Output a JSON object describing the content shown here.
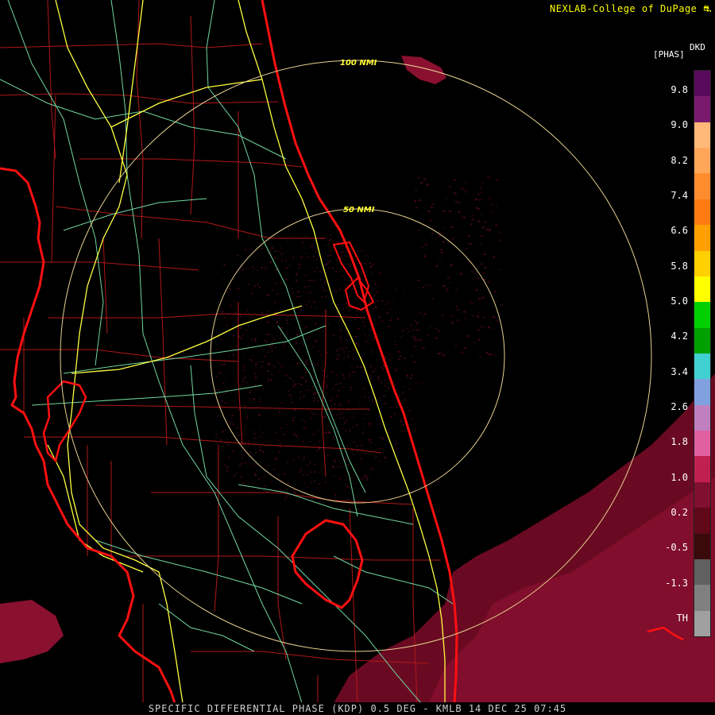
{
  "header": {
    "credit": "NEXLAB-College of DuPage",
    "credit_mark": "⛐"
  },
  "footer": {
    "caption": "SPECIFIC DIFFERENTIAL PHASE (KDP) 0.5 DEG - KMLB 14 DEC 25 07:45"
  },
  "range_rings": [
    {
      "label": "100 NMI"
    },
    {
      "label": "50 NMI"
    }
  ],
  "legend": {
    "unit": "[PHAS]",
    "code": "DKD",
    "ticks": [
      "9.8",
      "9.0",
      "8.2",
      "7.4",
      "6.6",
      "5.8",
      "5.0",
      "4.2",
      "3.4",
      "2.6",
      "1.8",
      "1.0",
      "0.2",
      "-0.5",
      "-1.3",
      "TH"
    ],
    "colors": [
      "#5a0a5a",
      "#7a1a6e",
      "#ffb877",
      "#ffa65a",
      "#ff8c2e",
      "#ff7a10",
      "#ffa000",
      "#ffd000",
      "#ffff00",
      "#00d000",
      "#00a000",
      "#40d0d0",
      "#80a0e0",
      "#c080c0",
      "#e060a0",
      "#c02050",
      "#801030",
      "#600818",
      "#3a0a0a",
      "#606060",
      "#808080",
      "#a0a0a0"
    ]
  },
  "colors": {
    "coastline": "#ff1010",
    "county_lines": "#b01818",
    "highways": "#ffff40",
    "roads": "#70d8a0",
    "range_rings": "#e8d090",
    "echo_dark": "#6a0a22",
    "echo_mid": "#8a1030"
  }
}
